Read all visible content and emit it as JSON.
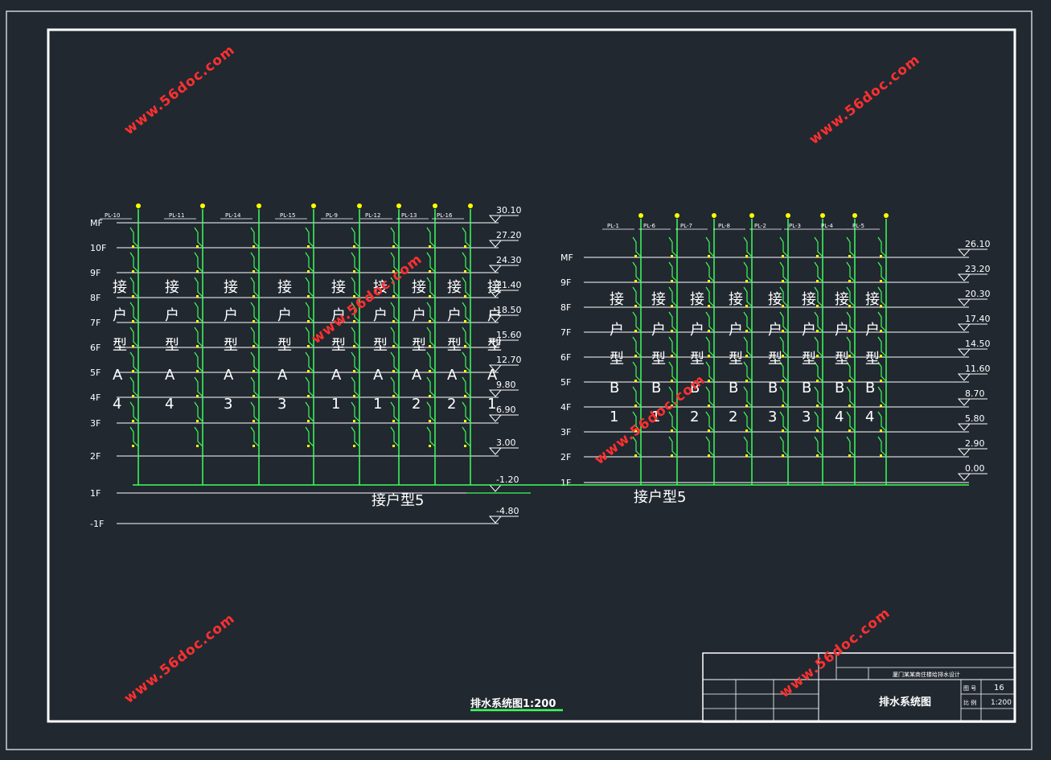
{
  "drawing_title": "排水系统图1:200",
  "left_building": {
    "floors": [
      "MF",
      "10F",
      "9F",
      "8F",
      "7F",
      "6F",
      "5F",
      "4F",
      "3F",
      "2F",
      "1F",
      "-1F"
    ],
    "elevations": [
      "30.10",
      "27.20",
      "24.30",
      "21.40",
      "18.50",
      "15.60",
      "12.70",
      "9.80",
      "6.90",
      "3.00",
      "-1.20",
      "-4.80"
    ],
    "pipes": [
      "PL-10",
      "PL-11",
      "PL-14",
      "PL-15",
      "PL-9",
      "PL-12",
      "PL-13",
      "PL-16"
    ],
    "unit_labels": [
      {
        "c1": "接",
        "c2": "户",
        "c3": "型",
        "c4": "A",
        "c5": "4"
      },
      {
        "c1": "接",
        "c2": "户",
        "c3": "型",
        "c4": "A",
        "c5": "4"
      },
      {
        "c1": "接",
        "c2": "户",
        "c3": "型",
        "c4": "A",
        "c5": "3"
      },
      {
        "c1": "接",
        "c2": "户",
        "c3": "型",
        "c4": "A",
        "c5": "3"
      },
      {
        "c1": "接",
        "c2": "户",
        "c3": "型",
        "c4": "A",
        "c5": "1"
      },
      {
        "c1": "接",
        "c2": "户",
        "c3": "型",
        "c4": "A",
        "c5": "1"
      },
      {
        "c1": "接",
        "c2": "户",
        "c3": "型",
        "c4": "A",
        "c5": "2"
      },
      {
        "c1": "接",
        "c2": "户",
        "c3": "型",
        "c4": "A",
        "c5": "2"
      },
      {
        "c1": "接",
        "c2": "户",
        "c3": "型",
        "c4": "A",
        "c5": "1"
      }
    ],
    "bottom_label": "接户型5"
  },
  "right_building": {
    "floors": [
      "MF",
      "9F",
      "8F",
      "7F",
      "6F",
      "5F",
      "4F",
      "3F",
      "2F",
      "1F"
    ],
    "elevations": [
      "26.10",
      "23.20",
      "20.30",
      "17.40",
      "14.50",
      "11.60",
      "8.70",
      "5.80",
      "2.90",
      "0.00"
    ],
    "pipes": [
      "PL-1",
      "PL-6",
      "PL-7",
      "PL-8",
      "PL-2",
      "PL-3",
      "PL-4",
      "PL-5"
    ],
    "unit_labels": [
      {
        "c1": "接",
        "c2": "户",
        "c3": "型",
        "c4": "B",
        "c5": "1"
      },
      {
        "c1": "接",
        "c2": "户",
        "c3": "型",
        "c4": "B",
        "c5": "1"
      },
      {
        "c1": "接",
        "c2": "户",
        "c3": "型",
        "c4": "B",
        "c5": "2"
      },
      {
        "c1": "接",
        "c2": "户",
        "c3": "型",
        "c4": "B",
        "c5": "2"
      },
      {
        "c1": "接",
        "c2": "户",
        "c3": "型",
        "c4": "B",
        "c5": "3"
      },
      {
        "c1": "接",
        "c2": "户",
        "c3": "型",
        "c4": "B",
        "c5": "3"
      },
      {
        "c1": "接",
        "c2": "户",
        "c3": "型",
        "c4": "B",
        "c5": "4"
      },
      {
        "c1": "接",
        "c2": "户",
        "c3": "型",
        "c4": "B",
        "c5": "4"
      }
    ],
    "bottom_label": "接户型5"
  },
  "watermark": "www.56doc.com",
  "title_block": {
    "project": "厦门某某商住楼给排水设计",
    "sheet_name": "排水系统图",
    "sheet_no_label": "图 号",
    "sheet_no": "16",
    "scale_label": "比 例",
    "scale": "1:200"
  },
  "colors": {
    "background": "#212830",
    "frame": "#ffffff",
    "pipe": "#3cff5a",
    "yellow": "#ffff00",
    "watermark": "#ff3030"
  }
}
